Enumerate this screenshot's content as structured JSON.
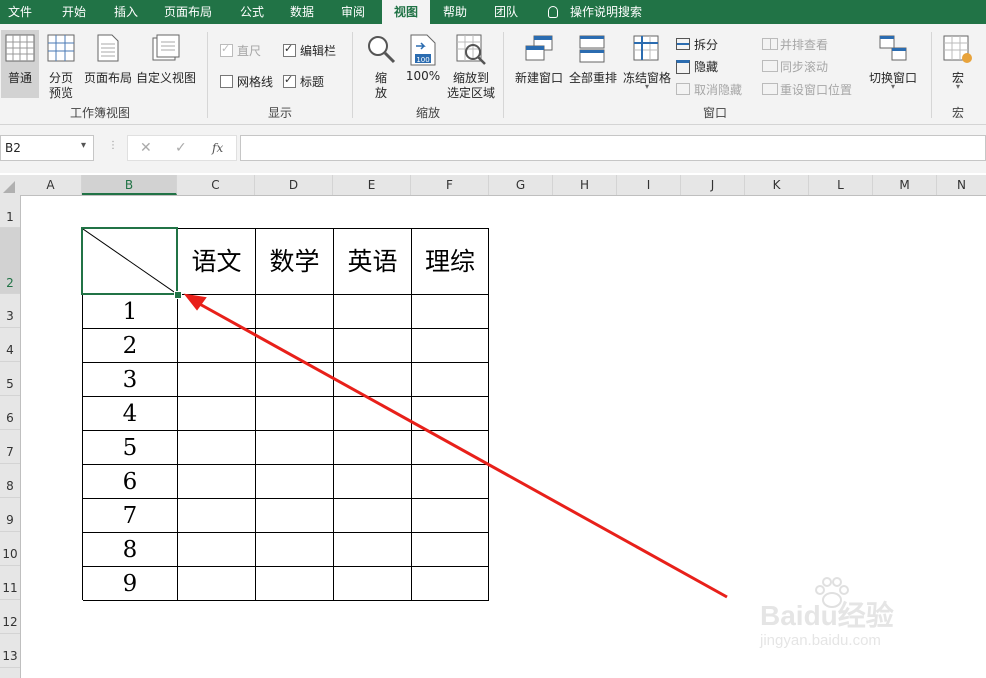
{
  "menu": {
    "tabs": [
      "文件",
      "开始",
      "插入",
      "页面布局",
      "公式",
      "数据",
      "审阅",
      "视图",
      "帮助",
      "团队"
    ],
    "active": "视图",
    "tell_me": "操作说明搜索"
  },
  "ribbon": {
    "workbook_views": {
      "normal": "普通",
      "page_break_1": "分页",
      "page_break_2": "预览",
      "page_layout": "页面布局",
      "custom_views": "自定义视图",
      "group_label": "工作簿视图"
    },
    "show": {
      "ruler": "直尺",
      "formula_bar": "编辑栏",
      "gridlines": "网格线",
      "headings": "标题",
      "group_label": "显示"
    },
    "zoom": {
      "zoom_1": "缩",
      "zoom_2": "放",
      "hundred": "100%",
      "zoom_sel_1": "缩放到",
      "zoom_sel_2": "选定区域",
      "group_label": "缩放",
      "icon_100": "100"
    },
    "window": {
      "new_window": "新建窗口",
      "arrange_all": "全部重排",
      "freeze_panes": "冻结窗格",
      "split": "拆分",
      "hide": "隐藏",
      "unhide": "取消隐藏",
      "side_by_side": "并排查看",
      "sync_scroll": "同步滚动",
      "reset_position": "重设窗口位置",
      "switch_windows": "切换窗口",
      "group_label": "窗口"
    },
    "macros": {
      "macros": "宏",
      "group_label": "宏"
    }
  },
  "formula_bar": {
    "name_box": "B2",
    "cancel_icon": "✕",
    "enter_icon": "✓",
    "fx": "fx",
    "content": ""
  },
  "sheet": {
    "columns": [
      "A",
      "B",
      "C",
      "D",
      "E",
      "F",
      "G",
      "H",
      "I",
      "J",
      "K",
      "L",
      "M",
      "N"
    ],
    "rows": [
      "1",
      "2",
      "3",
      "4",
      "5",
      "6",
      "7",
      "8",
      "9",
      "10",
      "11",
      "12",
      "13"
    ],
    "selected_cell": "B2",
    "table_headers": [
      "语文",
      "数学",
      "英语",
      "理综"
    ],
    "row_numbers": [
      "1",
      "2",
      "3",
      "4",
      "5",
      "6",
      "7",
      "8",
      "9"
    ]
  },
  "watermark": {
    "brand": "Baidu经验",
    "url": "jingyan.baidu.com"
  },
  "colors": {
    "excel_green": "#217346",
    "arrow_red": "#e8201a"
  }
}
